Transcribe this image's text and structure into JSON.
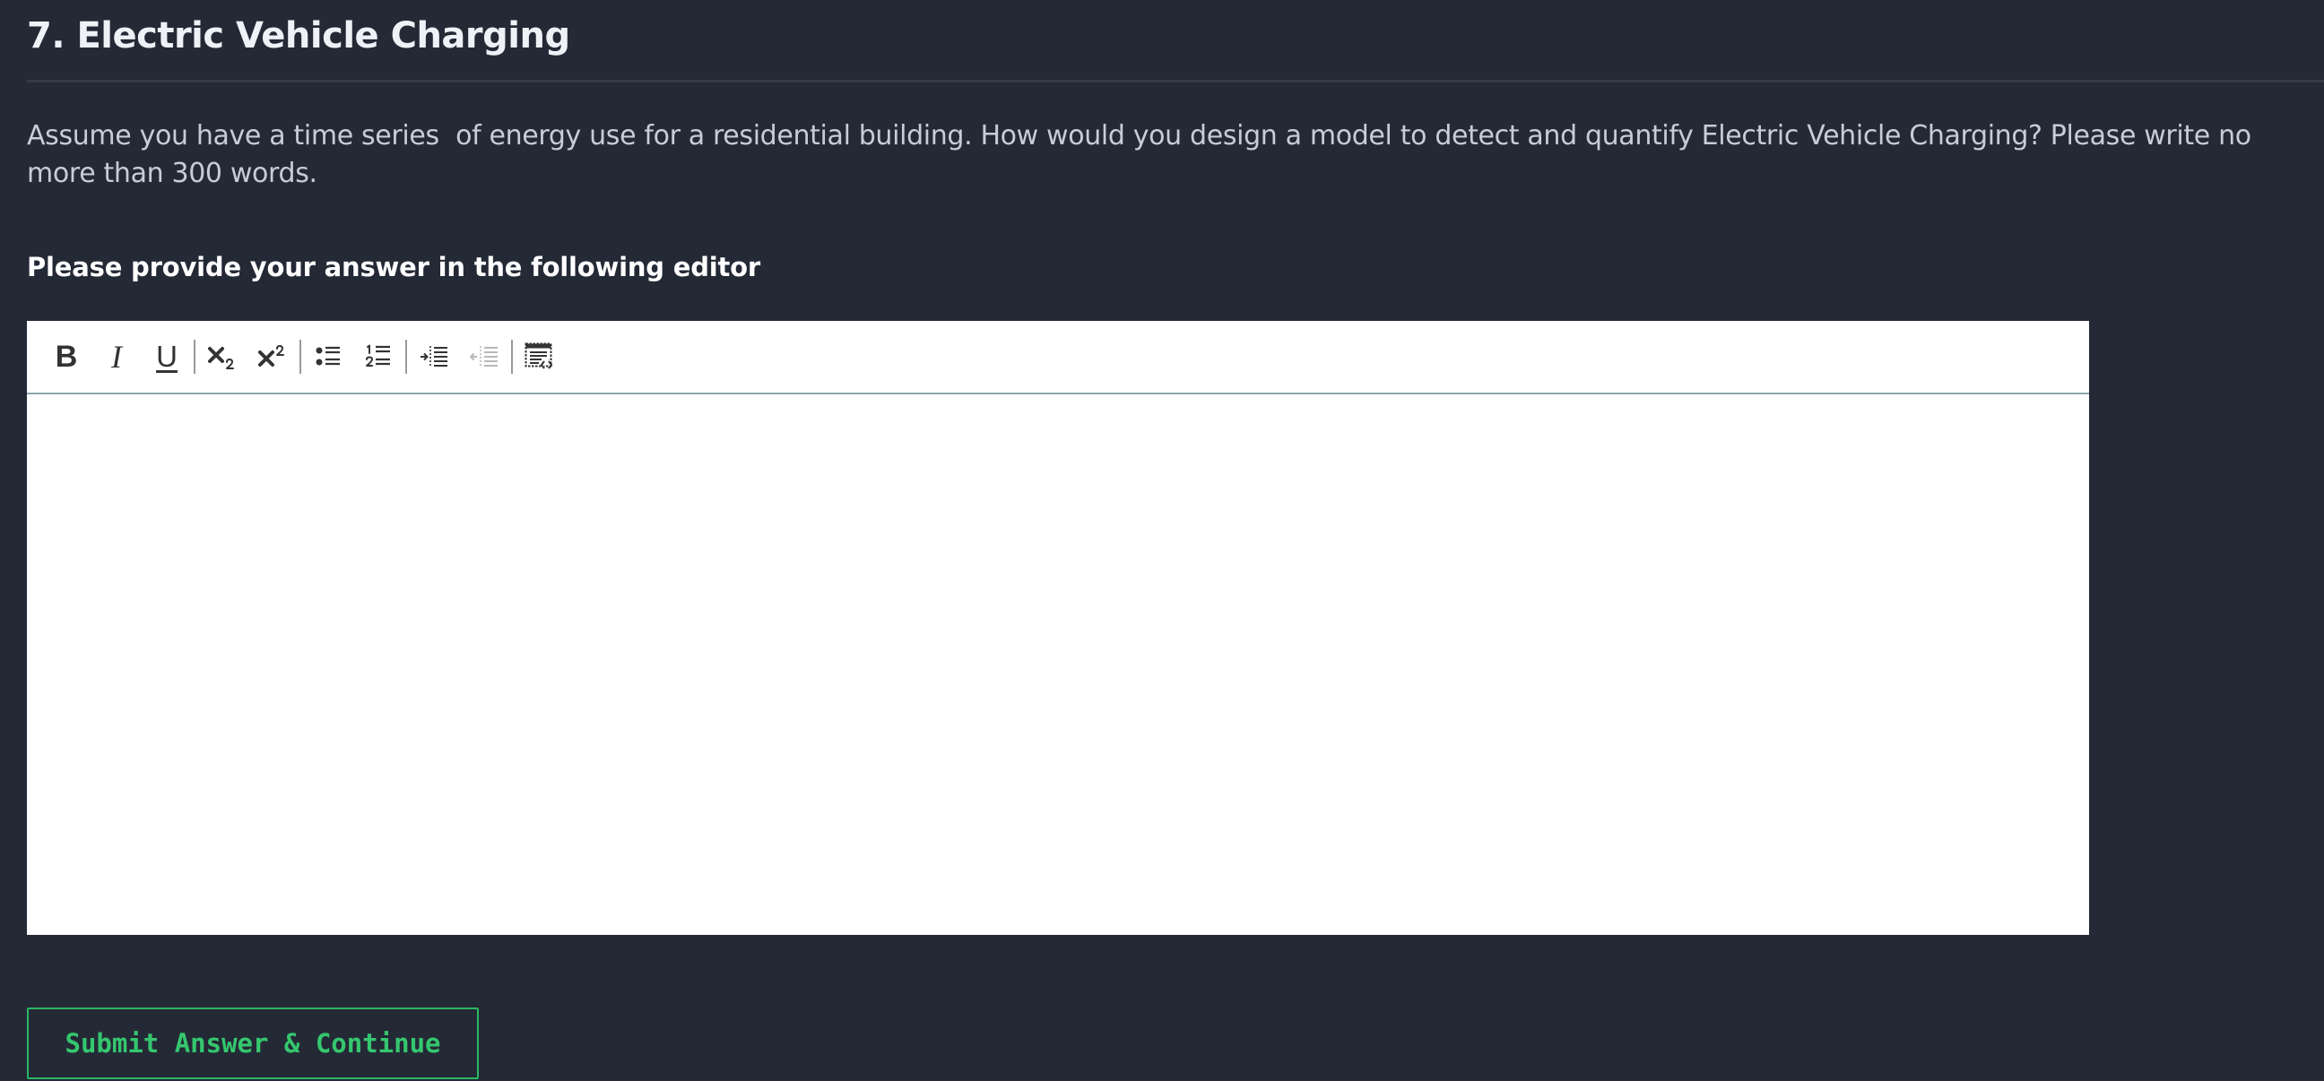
{
  "question": {
    "title": "7. Electric Vehicle Charging",
    "body": "Assume you have a time series  of energy use for a residential building. How would you design a model to detect and quantify Electric Vehicle Charging? Please write no more than 300 words."
  },
  "answer": {
    "label": "Please provide your answer in the following editor"
  },
  "editor": {
    "content": "",
    "toolbar": [
      {
        "name": "bold-icon",
        "label": "B"
      },
      {
        "name": "italic-icon",
        "label": "I"
      },
      {
        "name": "underline-icon",
        "label": "U"
      },
      {
        "name": "subscript-icon"
      },
      {
        "name": "superscript-icon"
      },
      {
        "name": "bulleted-list-icon"
      },
      {
        "name": "numbered-list-icon"
      },
      {
        "name": "indent-icon"
      },
      {
        "name": "outdent-icon"
      },
      {
        "name": "source-code-icon"
      }
    ]
  },
  "submit": {
    "label": "Submit Answer & Continue"
  },
  "colors": {
    "background": "#242936",
    "title_text": "#eef1f6",
    "body_text": "#c7ccd6",
    "editor_background": "#ffffff",
    "accent_green": "#35c76e"
  }
}
